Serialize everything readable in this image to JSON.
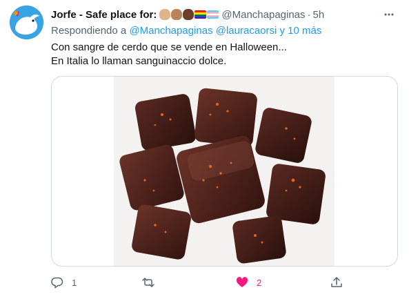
{
  "tweet": {
    "author_name": "Jorfe - Safe place for:",
    "author_emojis": [
      "raised-fist-medium-light",
      "raised-fist-medium",
      "raised-fist-dark",
      "rainbow-flag",
      "transgender-flag"
    ],
    "handle": "@Manchapaginas",
    "separator": "·",
    "time": "5h",
    "reply_prefix": "Respondiendo a",
    "reply_handles": "@Manchapaginas @lauracaorsi",
    "reply_more": "y 10 más",
    "text_lines": [
      "Con sangre de cerdo que se vende en Halloween...",
      "En Italia lo llaman sanguinaccio dolce."
    ],
    "media_alt_icon": "chocolate-squares-photo",
    "actions": {
      "reply_count": "1",
      "retweet_count": "",
      "like_count": "2",
      "share_count": ""
    }
  },
  "colors": {
    "accent": "#1d9bf0",
    "like": "#f91880",
    "secondary_text": "#536471",
    "border": "#cfd9de",
    "avatar_bg": "#3aa3e3"
  }
}
